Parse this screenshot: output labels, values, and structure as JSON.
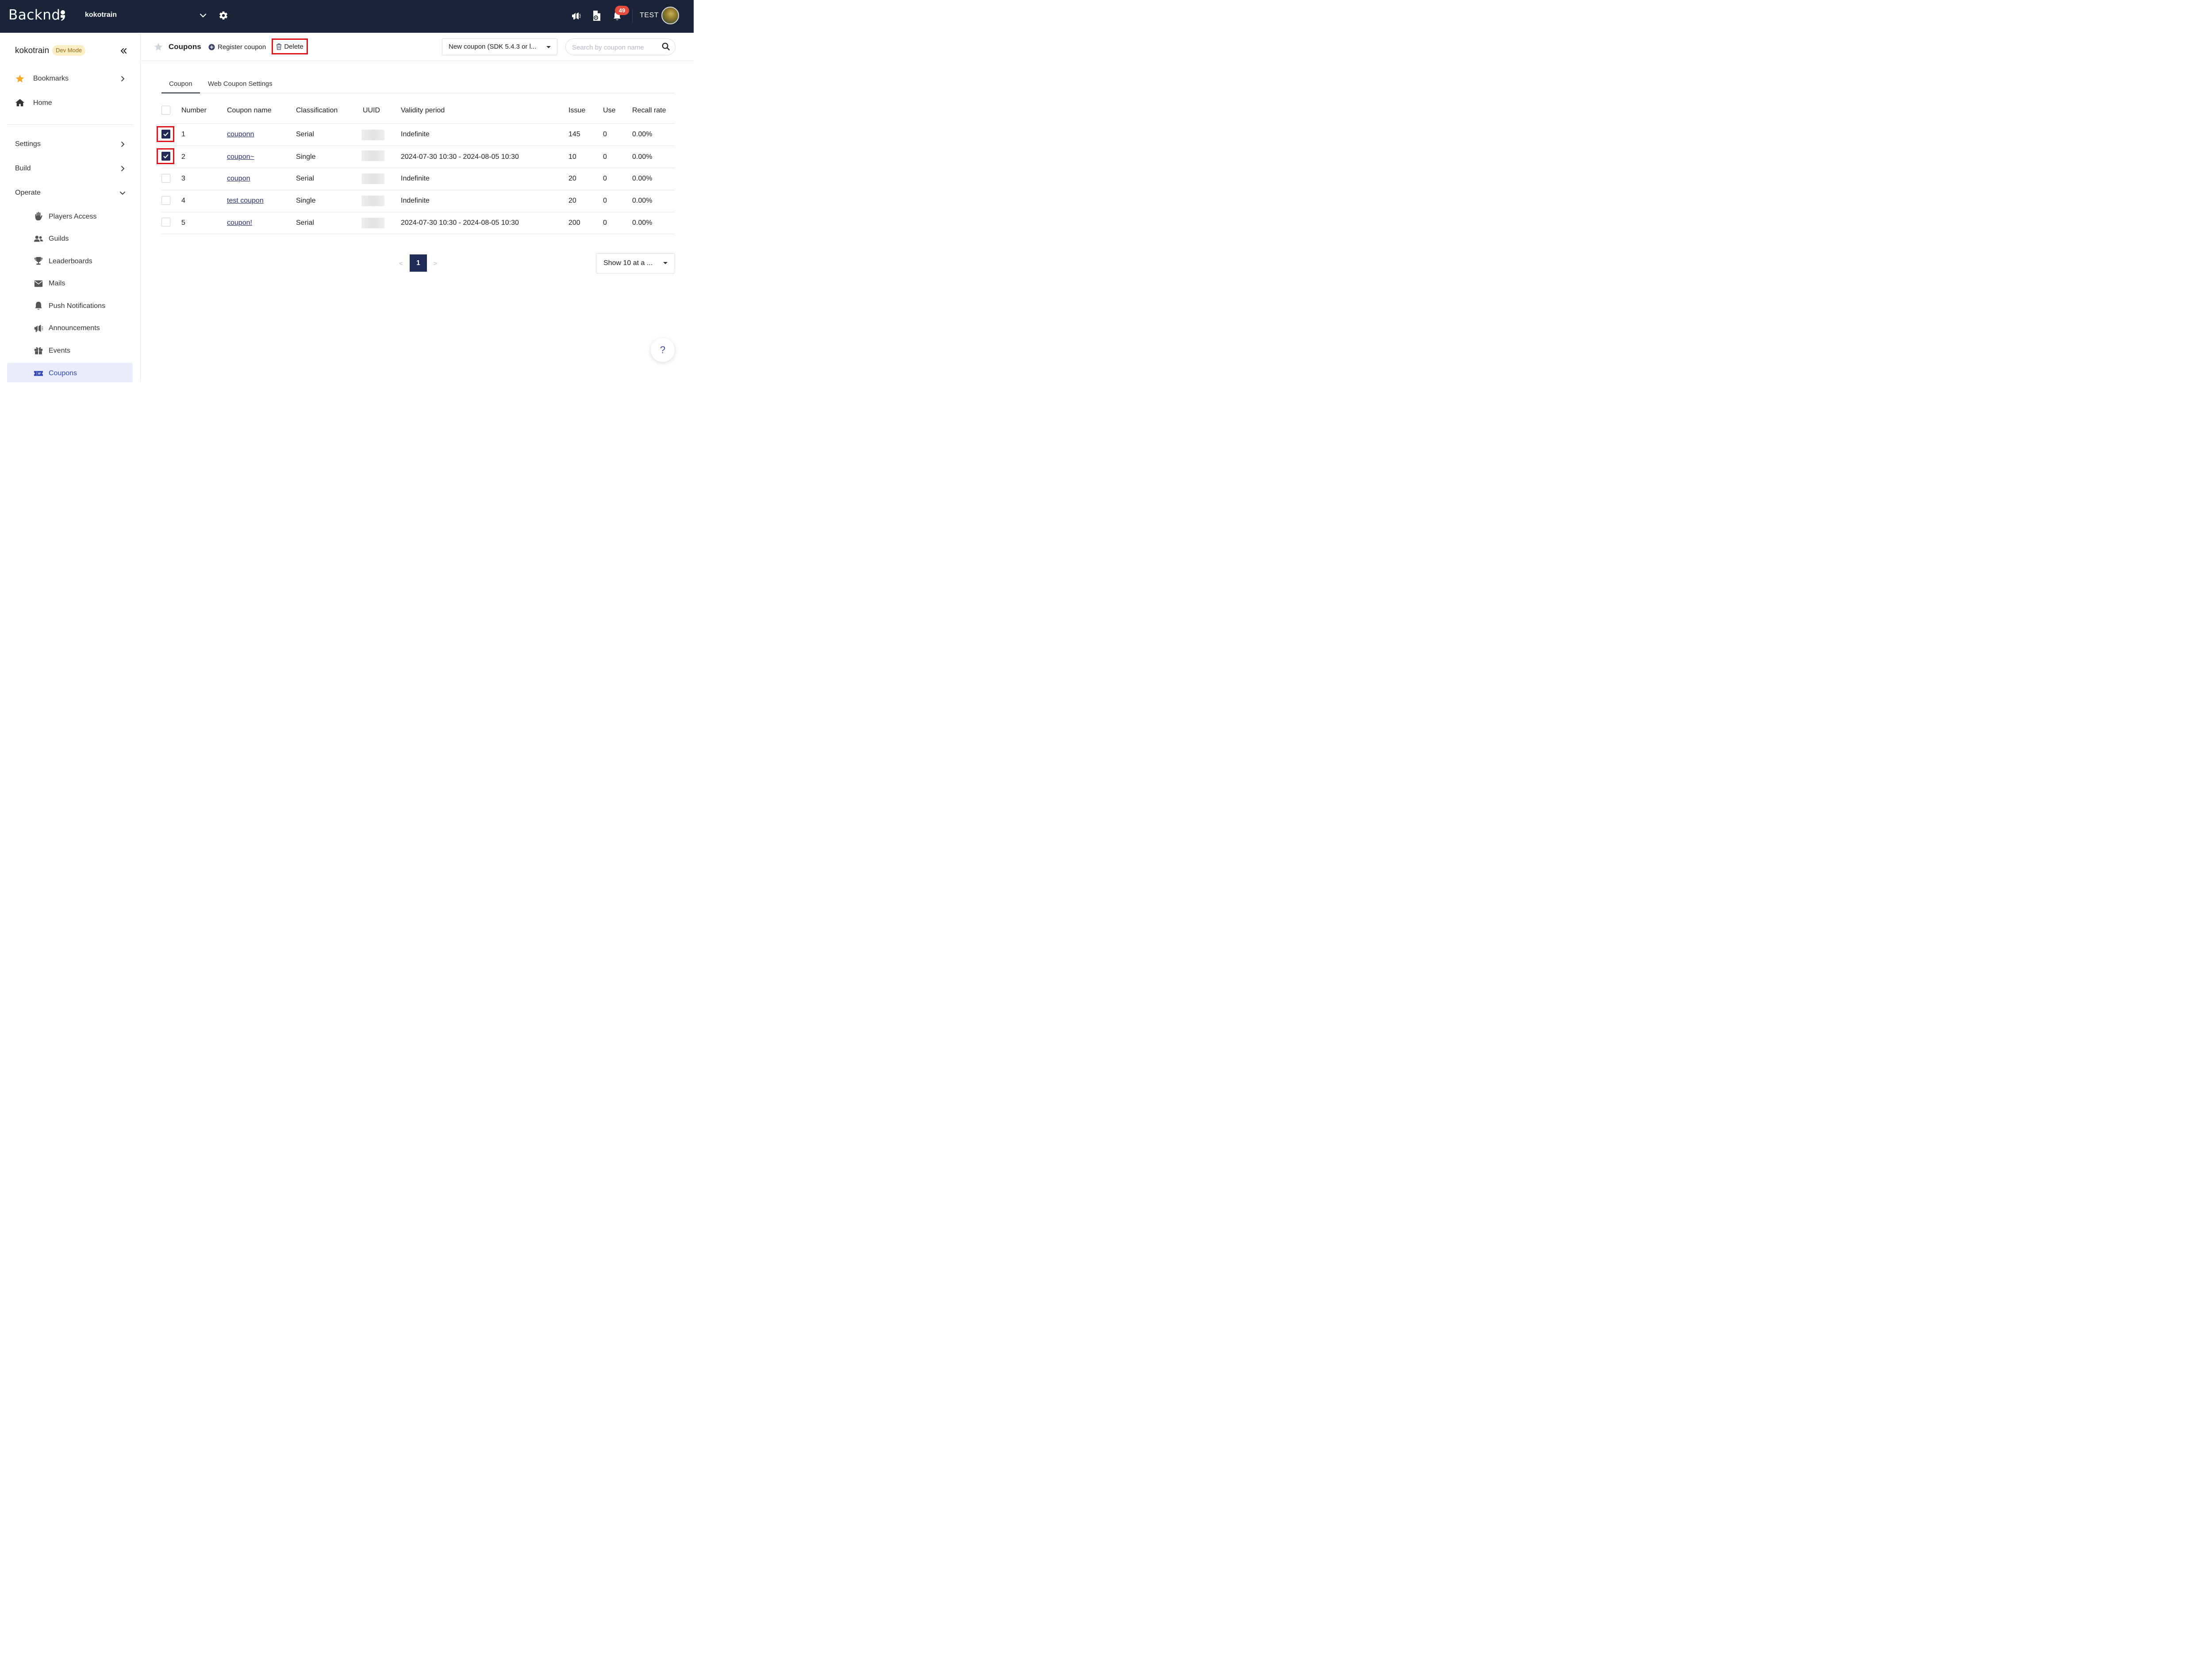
{
  "topbar": {
    "logo_text": "Backnd",
    "project_name": "kokotrain",
    "notification_count": "49",
    "user_name": "TEST"
  },
  "sidebar": {
    "project_name": "kokotrain",
    "mode_badge": "Dev Mode",
    "top_items": [
      {
        "label": "Bookmarks",
        "icon": "star-icon"
      },
      {
        "label": "Home",
        "icon": "home-icon"
      }
    ],
    "sections": [
      {
        "label": "Settings"
      },
      {
        "label": "Build"
      },
      {
        "label": "Operate"
      }
    ],
    "operate_items": [
      {
        "label": "Players Access",
        "icon": "hand-icon"
      },
      {
        "label": "Guilds",
        "icon": "users-icon"
      },
      {
        "label": "Leaderboards",
        "icon": "trophy-icon"
      },
      {
        "label": "Mails",
        "icon": "envelope-icon"
      },
      {
        "label": "Push Notifications",
        "icon": "bell-icon"
      },
      {
        "label": "Announcements",
        "icon": "megaphone-icon"
      },
      {
        "label": "Events",
        "icon": "gift-icon"
      },
      {
        "label": "Coupons",
        "icon": "ticket-icon",
        "active": true
      }
    ]
  },
  "header": {
    "title": "Coupons",
    "register_label": "Register coupon",
    "delete_label": "Delete",
    "version_select": "New coupon (SDK 5.4.3 or l...",
    "search_placeholder": "Search by coupon name"
  },
  "tabs": [
    {
      "label": "Coupon",
      "active": true
    },
    {
      "label": "Web Coupon Settings",
      "active": false
    }
  ],
  "table": {
    "columns": [
      "Number",
      "Coupon name",
      "Classification",
      "UUID",
      "Validity period",
      "Issue",
      "Use",
      "Recall rate"
    ],
    "rows": [
      {
        "checked": true,
        "number": "1",
        "name": "couponn",
        "classification": "Serial",
        "validity": "Indefinite",
        "issue": "145",
        "use": "0",
        "recall": "0.00%"
      },
      {
        "checked": true,
        "number": "2",
        "name": "coupon~",
        "classification": "Single",
        "validity": "2024-07-30 10:30 - 2024-08-05 10:30",
        "issue": "10",
        "use": "0",
        "recall": "0.00%"
      },
      {
        "checked": false,
        "number": "3",
        "name": "coupon",
        "classification": "Serial",
        "validity": "Indefinite",
        "issue": "20",
        "use": "0",
        "recall": "0.00%"
      },
      {
        "checked": false,
        "number": "4",
        "name": "test coupon",
        "classification": "Single",
        "validity": "Indefinite",
        "issue": "20",
        "use": "0",
        "recall": "0.00%"
      },
      {
        "checked": false,
        "number": "5",
        "name": "coupon!",
        "classification": "Serial",
        "validity": "2024-07-30 10:30 - 2024-08-05 10:30",
        "issue": "200",
        "use": "0",
        "recall": "0.00%"
      }
    ]
  },
  "pagination": {
    "prev": "<",
    "current": "1",
    "next": ">",
    "page_size": "Show 10 at a ..."
  },
  "help_label": "?",
  "colors": {
    "topbar_bg": "#1b2338",
    "accent": "#1f2a56",
    "highlight_red": "#e0131b",
    "badge_red": "#e94b3c",
    "dev_badge_bg": "#fbedc4",
    "active_item_bg": "#e9ecfa"
  }
}
